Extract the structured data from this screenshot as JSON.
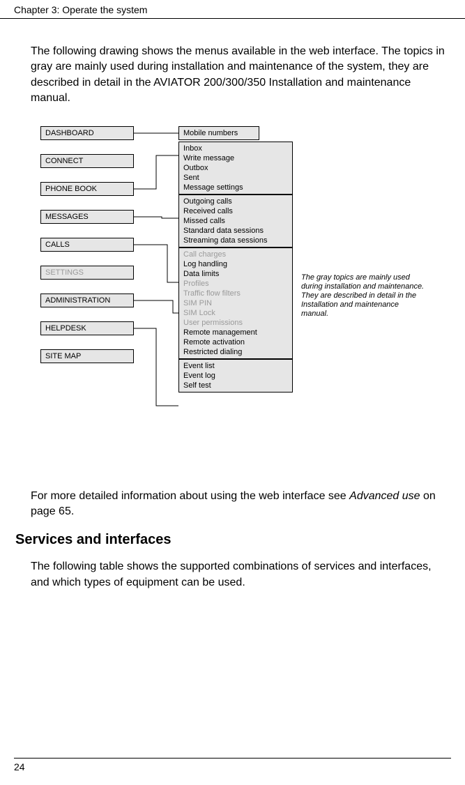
{
  "header": {
    "chapter": "Chapter 3:  Operate the system"
  },
  "intro": {
    "p1": "The following drawing shows the menus available in the web interface. The topics in gray are mainly used during installation and maintenance of the system, they are described in detail in the AVIATOR 200/300/350 Installation and maintenance manual."
  },
  "menus": {
    "dashboard": "DASHBOARD",
    "connect": "CONNECT",
    "phonebook": "PHONE BOOK",
    "messages": "MESSAGES",
    "calls": "CALLS",
    "settings": "SETTINGS",
    "administration": "ADMINISTRATION",
    "helpdesk": "HELPDESK",
    "sitemap": "SITE MAP"
  },
  "sub": {
    "phonebook": {
      "mobile": "Mobile numbers"
    },
    "messages": {
      "inbox": "Inbox",
      "write": "Write message",
      "outbox": "Outbox",
      "sent": "Sent",
      "settings": "Message settings"
    },
    "calls": {
      "out": "Outgoing calls",
      "rec": "Received calls",
      "missed": "Missed calls",
      "std": "Standard data sessions",
      "stream": "Streaming data sessions"
    },
    "admin": {
      "charges": "Call charges",
      "log": "Log handling",
      "limits": "Data limits",
      "profiles": "Profiles",
      "traffic": "Traffic flow filters",
      "simpin": "SIM PIN",
      "simlock": "SIM Lock",
      "perms": "User permissions",
      "remmgr": "Remote management",
      "remact": "Remote activation",
      "restrict": "Restricted dialing"
    },
    "helpdesk": {
      "evlist": "Event list",
      "evlog": "Event log",
      "selftest": "Self test"
    }
  },
  "note": "The gray topics are mainly used during installation and maintenance. They are described in detail in the Installation and maintenance manual.",
  "outro": {
    "lead": "For more detailed information about using the web interface see ",
    "link": "Advanced use",
    "tail": " on page 65."
  },
  "h2": "Services and interfaces",
  "p3": "The following table shows the supported combinations of services and interfaces, and which types of equipment can be used.",
  "footer": {
    "page": "24"
  }
}
